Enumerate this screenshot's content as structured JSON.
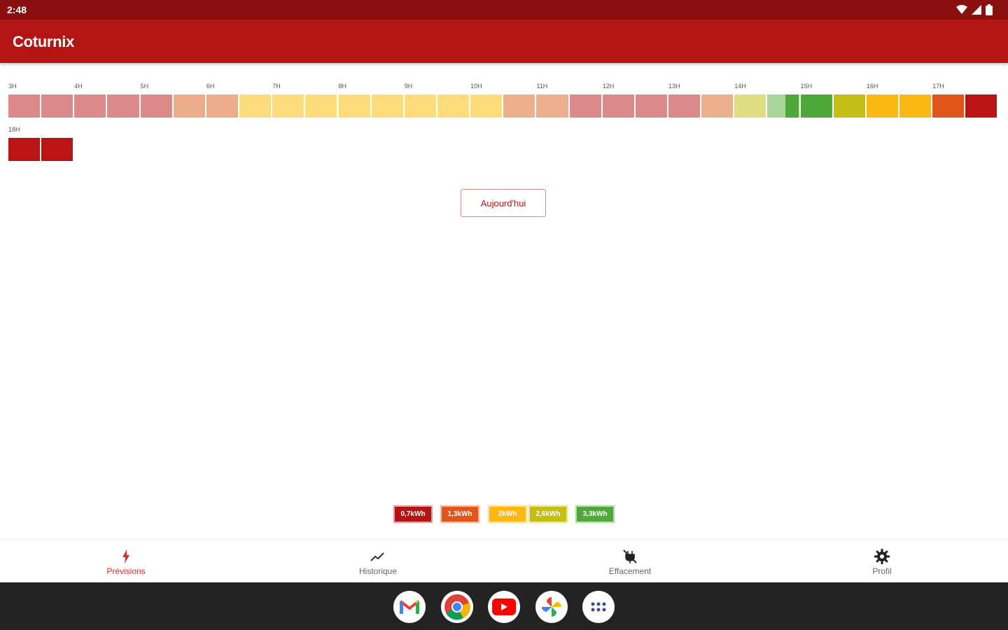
{
  "status_bar": {
    "time": "2:48",
    "icons": [
      "wifi-icon",
      "signal-icon",
      "battery-icon"
    ]
  },
  "app_bar": {
    "title": "Coturnix"
  },
  "timeline": {
    "hour_labels_row1": [
      "3H",
      "4H",
      "5H",
      "6H",
      "7H",
      "8H",
      "9H",
      "10H",
      "11H",
      "12H",
      "13H",
      "14H",
      "15H",
      "16H",
      "17H"
    ],
    "hour_labels_row2": [
      "18H"
    ],
    "colors": {
      "pink": "#dc8a8a",
      "peach": "#ecae8a",
      "yellow": "#fddd7c",
      "orange_light": "#ecb08e",
      "lime_light": "#dedd7f",
      "green_light": "#aad49a",
      "green": "#4ea83a",
      "olive": "#c2be14",
      "amber": "#fdb913",
      "orange": "#e0561a",
      "red": "#bb1414"
    }
  },
  "actions": {
    "today_label": "Aujourd'hui"
  },
  "legend": [
    {
      "label": "0,7kWh",
      "color": "#b31414"
    },
    {
      "label": "1,3kWh",
      "color": "#e0561a"
    },
    {
      "label": "2kWh",
      "color": "#fdb913"
    },
    {
      "label": "2,6kWh",
      "color": "#c2be14"
    },
    {
      "label": "3,3kWh",
      "color": "#4ea83a"
    }
  ],
  "bottom_nav": [
    {
      "label": "Prévisions",
      "icon": "lightning-icon",
      "active": true
    },
    {
      "label": "Historique",
      "icon": "trend-icon",
      "active": false
    },
    {
      "label": "Effacement",
      "icon": "no-plug-icon",
      "active": false
    },
    {
      "label": "Profil",
      "icon": "gear-icon",
      "active": false
    }
  ],
  "dock": [
    "gmail-icon",
    "chrome-icon",
    "youtube-icon",
    "photos-icon",
    "apps-icon"
  ]
}
